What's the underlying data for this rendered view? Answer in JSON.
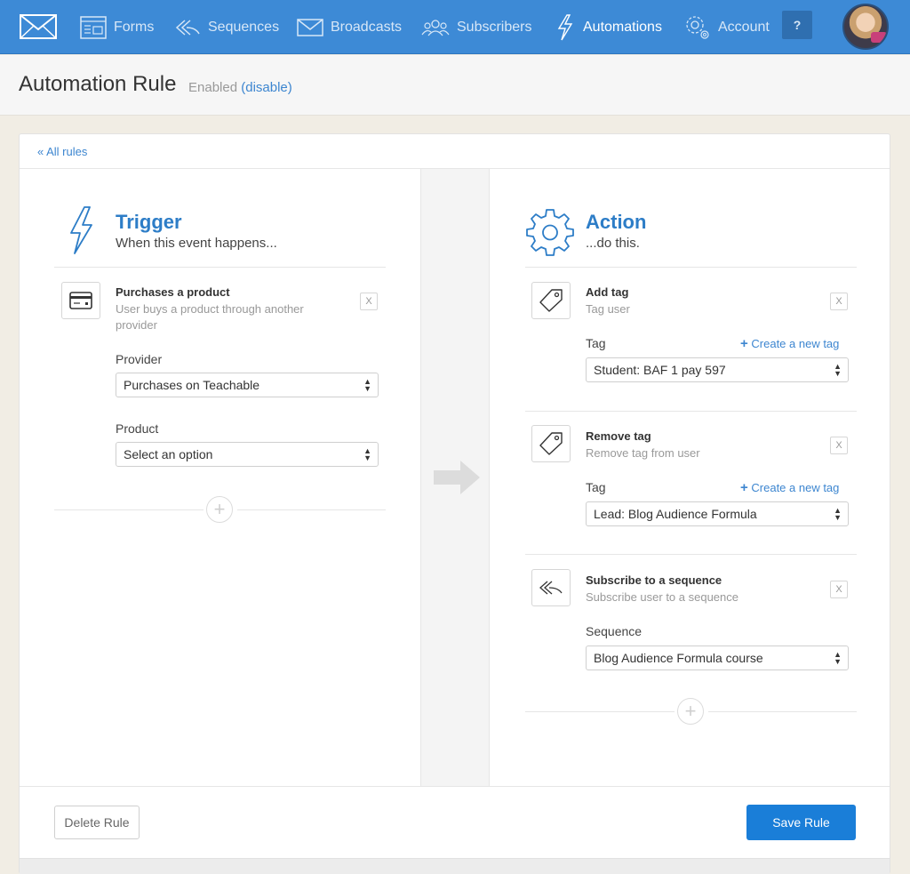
{
  "nav": {
    "items": [
      {
        "label": "Forms",
        "icon": "forms-icon"
      },
      {
        "label": "Sequences",
        "icon": "sequences-icon"
      },
      {
        "label": "Broadcasts",
        "icon": "broadcasts-icon"
      },
      {
        "label": "Subscribers",
        "icon": "subscribers-icon"
      },
      {
        "label": "Automations",
        "icon": "automations-icon"
      },
      {
        "label": "Account",
        "icon": "gear-icon"
      }
    ],
    "help_label": "?"
  },
  "header": {
    "title": "Automation Rule",
    "status": "Enabled",
    "toggle_link": "(disable)"
  },
  "back_link": "« All rules",
  "trigger": {
    "title": "Trigger",
    "subtitle": "When this event happens...",
    "item": {
      "title": "Purchases a product",
      "description": "User buys a product through another provider",
      "remove": "X"
    },
    "provider_label": "Provider",
    "provider_value": "Purchases on Teachable",
    "product_label": "Product",
    "product_value": "Select an option",
    "add_label": "+"
  },
  "action": {
    "title": "Action",
    "subtitle": "...do this.",
    "items": [
      {
        "title": "Add tag",
        "description": "Tag user",
        "remove": "X",
        "field_label": "Tag",
        "create_link": "Create a new tag",
        "value": "Student: BAF 1 pay 597"
      },
      {
        "title": "Remove tag",
        "description": "Remove tag from user",
        "remove": "X",
        "field_label": "Tag",
        "create_link": "Create a new tag",
        "value": "Lead: Blog Audience Formula"
      },
      {
        "title": "Subscribe to a sequence",
        "description": "Subscribe user to a sequence",
        "remove": "X",
        "field_label": "Sequence",
        "value": "Blog Audience Formula course"
      }
    ],
    "add_label": "+"
  },
  "footer": {
    "delete_label": "Delete Rule",
    "save_label": "Save Rule"
  },
  "colors": {
    "nav_bg": "#3d8ad6",
    "accent": "#2d7dc7",
    "save_button": "#1a7ed8",
    "page_bg": "#f1ede4"
  }
}
